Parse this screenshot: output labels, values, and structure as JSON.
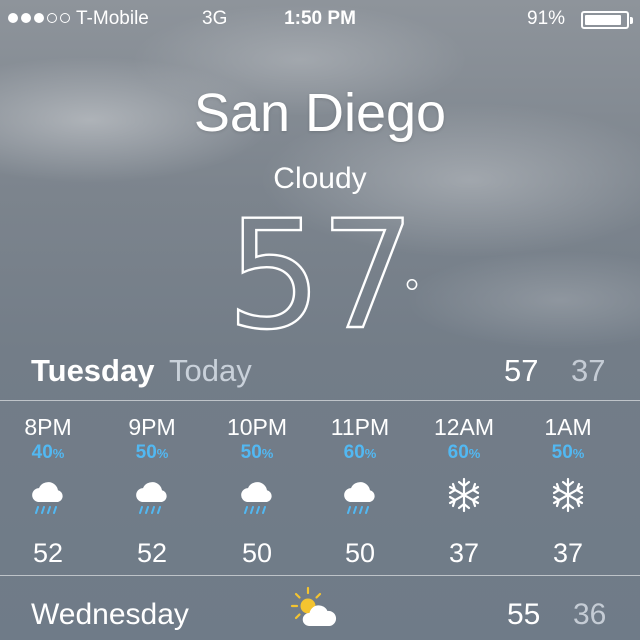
{
  "status_bar": {
    "carrier": "T-Mobile",
    "network": "3G",
    "time": "1:50 PM",
    "battery_percent": "91%",
    "battery_level": 0.91,
    "signal_bars_filled": 3,
    "signal_bars_total": 5
  },
  "weather": {
    "city": "San Diego",
    "condition": "Cloudy",
    "temperature": "57",
    "degree_symbol": "°"
  },
  "today": {
    "day": "Tuesday",
    "label": "Today",
    "high": "57",
    "low": "37"
  },
  "hourly": [
    {
      "time": "8PM",
      "precip": "40",
      "precip_unit": "%",
      "icon": "rain-icon",
      "temp": "52"
    },
    {
      "time": "9PM",
      "precip": "50",
      "precip_unit": "%",
      "icon": "rain-icon",
      "temp": "52"
    },
    {
      "time": "10PM",
      "precip": "50",
      "precip_unit": "%",
      "icon": "rain-icon",
      "temp": "50"
    },
    {
      "time": "11PM",
      "precip": "60",
      "precip_unit": "%",
      "icon": "rain-icon",
      "temp": "50"
    },
    {
      "time": "12AM",
      "precip": "60",
      "precip_unit": "%",
      "icon": "snowflake-icon",
      "temp": "37"
    },
    {
      "time": "1AM",
      "precip": "50",
      "precip_unit": "%",
      "icon": "snowflake-icon",
      "temp": "37"
    }
  ],
  "forecast": [
    {
      "day": "Wednesday",
      "icon": "partly-sunny-icon",
      "high": "55",
      "low": "36"
    }
  ],
  "colors": {
    "precip_accent": "#52b8f2",
    "sun": "#f4c430",
    "text": "#ffffff"
  }
}
